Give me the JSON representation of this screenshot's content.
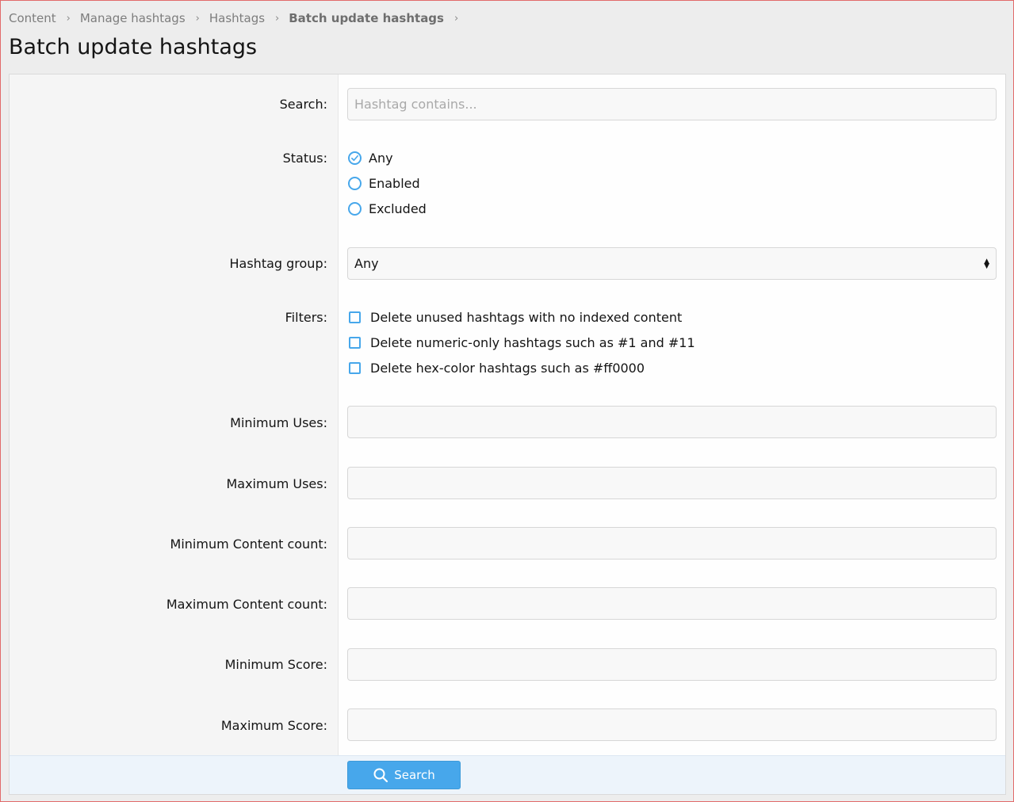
{
  "breadcrumb": [
    {
      "label": "Content"
    },
    {
      "label": "Manage hashtags"
    },
    {
      "label": "Hashtags"
    },
    {
      "label": "Batch update hashtags"
    }
  ],
  "breadcrumb_separator": "›",
  "page_title": "Batch update hashtags",
  "form": {
    "search": {
      "label": "Search:",
      "placeholder": "Hashtag contains...",
      "value": ""
    },
    "status": {
      "label": "Status:",
      "options": [
        {
          "label": "Any",
          "selected": true
        },
        {
          "label": "Enabled",
          "selected": false
        },
        {
          "label": "Excluded",
          "selected": false
        }
      ]
    },
    "hashtag_group": {
      "label": "Hashtag group:",
      "value": "Any"
    },
    "filters": {
      "label": "Filters:",
      "options": [
        {
          "label": "Delete unused hashtags with no indexed content",
          "checked": false
        },
        {
          "label": "Delete numeric-only hashtags such as #1 and #11",
          "checked": false
        },
        {
          "label": "Delete hex-color hashtags such as #ff0000",
          "checked": false
        }
      ]
    },
    "minimum_uses": {
      "label": "Minimum Uses:",
      "value": ""
    },
    "maximum_uses": {
      "label": "Maximum Uses:",
      "value": ""
    },
    "minimum_content_count": {
      "label": "Minimum Content count:",
      "value": ""
    },
    "maximum_content_count": {
      "label": "Maximum Content count:",
      "value": ""
    },
    "minimum_score": {
      "label": "Minimum Score:",
      "value": ""
    },
    "maximum_score": {
      "label": "Maximum Score:",
      "value": ""
    }
  },
  "submit": {
    "label": "Search",
    "icon": "search-icon"
  },
  "colors": {
    "accent": "#47a7eb",
    "footer_bg": "#edf4fb",
    "window_border": "#e26a6a"
  }
}
